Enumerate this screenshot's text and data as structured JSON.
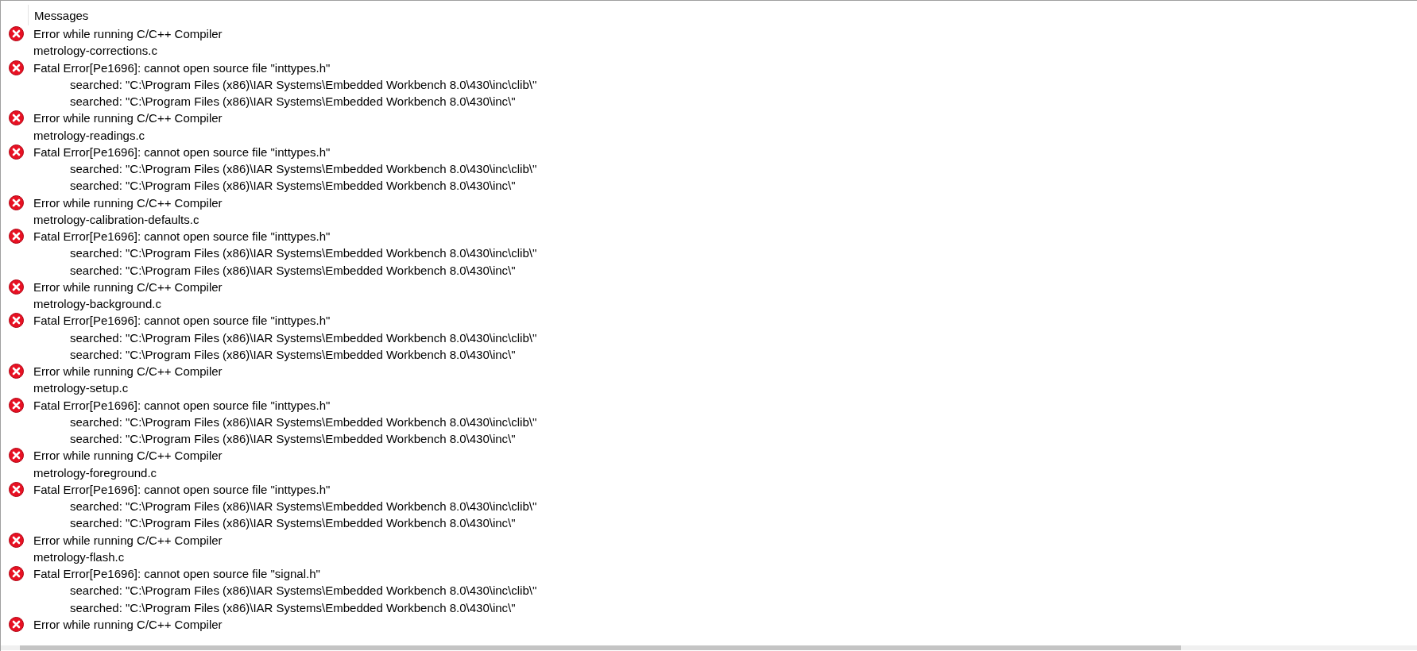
{
  "panel": {
    "header": "Messages"
  },
  "messages": [
    {
      "kind": "error",
      "text": "Error while running C/C++ Compiler"
    },
    {
      "kind": "file",
      "text": "metrology-corrections.c"
    },
    {
      "kind": "error",
      "text": "Fatal Error[Pe1696]: cannot open source file \"inttypes.h\""
    },
    {
      "kind": "detail",
      "text": "searched: \"C:\\Program Files (x86)\\IAR Systems\\Embedded Workbench 8.0\\430\\inc\\clib\\\""
    },
    {
      "kind": "detail",
      "text": "searched: \"C:\\Program Files (x86)\\IAR Systems\\Embedded Workbench 8.0\\430\\inc\\\""
    },
    {
      "kind": "error",
      "text": "Error while running C/C++ Compiler"
    },
    {
      "kind": "file",
      "text": "metrology-readings.c"
    },
    {
      "kind": "error",
      "text": "Fatal Error[Pe1696]: cannot open source file \"inttypes.h\""
    },
    {
      "kind": "detail",
      "text": "searched: \"C:\\Program Files (x86)\\IAR Systems\\Embedded Workbench 8.0\\430\\inc\\clib\\\""
    },
    {
      "kind": "detail",
      "text": "searched: \"C:\\Program Files (x86)\\IAR Systems\\Embedded Workbench 8.0\\430\\inc\\\""
    },
    {
      "kind": "error",
      "text": "Error while running C/C++ Compiler"
    },
    {
      "kind": "file",
      "text": "metrology-calibration-defaults.c"
    },
    {
      "kind": "error",
      "text": "Fatal Error[Pe1696]: cannot open source file \"inttypes.h\""
    },
    {
      "kind": "detail",
      "text": "searched: \"C:\\Program Files (x86)\\IAR Systems\\Embedded Workbench 8.0\\430\\inc\\clib\\\""
    },
    {
      "kind": "detail",
      "text": "searched: \"C:\\Program Files (x86)\\IAR Systems\\Embedded Workbench 8.0\\430\\inc\\\""
    },
    {
      "kind": "error",
      "text": "Error while running C/C++ Compiler"
    },
    {
      "kind": "file",
      "text": "metrology-background.c"
    },
    {
      "kind": "error",
      "text": "Fatal Error[Pe1696]: cannot open source file \"inttypes.h\""
    },
    {
      "kind": "detail",
      "text": "searched: \"C:\\Program Files (x86)\\IAR Systems\\Embedded Workbench 8.0\\430\\inc\\clib\\\""
    },
    {
      "kind": "detail",
      "text": "searched: \"C:\\Program Files (x86)\\IAR Systems\\Embedded Workbench 8.0\\430\\inc\\\""
    },
    {
      "kind": "error",
      "text": "Error while running C/C++ Compiler"
    },
    {
      "kind": "file",
      "text": "metrology-setup.c"
    },
    {
      "kind": "error",
      "text": "Fatal Error[Pe1696]: cannot open source file \"inttypes.h\""
    },
    {
      "kind": "detail",
      "text": "searched: \"C:\\Program Files (x86)\\IAR Systems\\Embedded Workbench 8.0\\430\\inc\\clib\\\""
    },
    {
      "kind": "detail",
      "text": "searched: \"C:\\Program Files (x86)\\IAR Systems\\Embedded Workbench 8.0\\430\\inc\\\""
    },
    {
      "kind": "error",
      "text": "Error while running C/C++ Compiler"
    },
    {
      "kind": "file",
      "text": "metrology-foreground.c"
    },
    {
      "kind": "error",
      "text": "Fatal Error[Pe1696]: cannot open source file \"inttypes.h\""
    },
    {
      "kind": "detail",
      "text": "searched: \"C:\\Program Files (x86)\\IAR Systems\\Embedded Workbench 8.0\\430\\inc\\clib\\\""
    },
    {
      "kind": "detail",
      "text": "searched: \"C:\\Program Files (x86)\\IAR Systems\\Embedded Workbench 8.0\\430\\inc\\\""
    },
    {
      "kind": "error",
      "text": "Error while running C/C++ Compiler"
    },
    {
      "kind": "file",
      "text": "metrology-flash.c"
    },
    {
      "kind": "error",
      "text": "Fatal Error[Pe1696]: cannot open source file \"signal.h\""
    },
    {
      "kind": "detail",
      "text": "searched: \"C:\\Program Files (x86)\\IAR Systems\\Embedded Workbench 8.0\\430\\inc\\clib\\\""
    },
    {
      "kind": "detail",
      "text": "searched: \"C:\\Program Files (x86)\\IAR Systems\\Embedded Workbench 8.0\\430\\inc\\\""
    },
    {
      "kind": "error",
      "text": "Error while running C/C++ Compiler"
    }
  ]
}
